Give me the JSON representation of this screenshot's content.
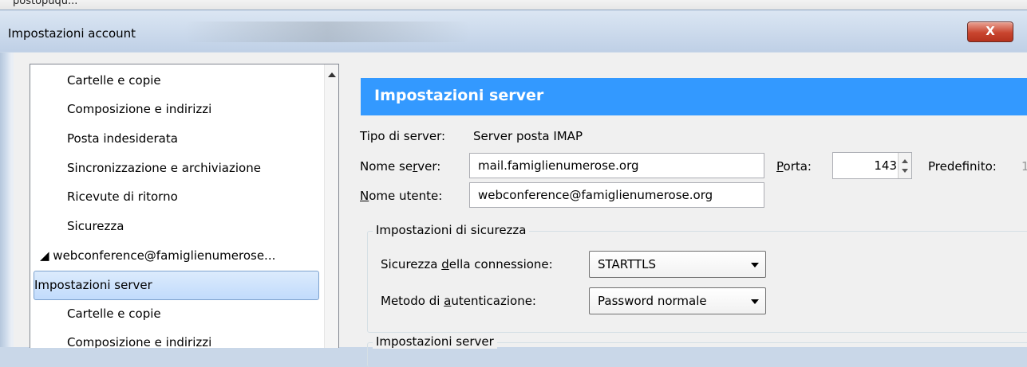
{
  "window": {
    "title": "Impostazioni account",
    "close_label": "X",
    "top_strip_text": "postopuqu..."
  },
  "tree": {
    "items": [
      {
        "label": "Cartelle e copie",
        "type": "child"
      },
      {
        "label": "Composizione e indirizzi",
        "type": "child"
      },
      {
        "label": "Posta indesiderata",
        "type": "child"
      },
      {
        "label": "Sincronizzazione e archiviazione",
        "type": "child"
      },
      {
        "label": "Ricevute di ritorno",
        "type": "child"
      },
      {
        "label": "Sicurezza",
        "type": "child"
      },
      {
        "label": "◢ webconference@famiglienumerose...",
        "type": "parent"
      },
      {
        "label": "Impostazioni server",
        "type": "selected"
      },
      {
        "label": "Cartelle e copie",
        "type": "child"
      },
      {
        "label": "Composizione e indirizzi",
        "type": "child"
      }
    ]
  },
  "panel": {
    "header": "Impostazioni server",
    "server_type_label": "Tipo di server:",
    "server_type_value": "Server posta IMAP",
    "server_name_label_pre": "Nome se",
    "server_name_label_ul": "r",
    "server_name_label_post": "ver:",
    "server_name_value": "mail.famiglienumerose.org",
    "port_label_ul": "P",
    "port_label_post": "orta:",
    "port_value": "143",
    "default_label": "Predefinito:",
    "default_value": "1",
    "username_label_ul": "N",
    "username_label_post": "ome utente:",
    "username_value": "webconference@famiglienumerose.org",
    "security_group_label": "Impostazioni di sicurezza",
    "connection_security_label_pre": "Sicurezza ",
    "connection_security_label_ul": "d",
    "connection_security_label_post": "ella connessione:",
    "connection_security_value": "STARTTLS",
    "auth_method_label_pre": "Metodo di ",
    "auth_method_label_ul": "a",
    "auth_method_label_post": "utenticazione:",
    "auth_method_value": "Password normale",
    "server_group_label": "Impostazioni server"
  },
  "colors": {
    "header_bg": "#3399ff",
    "selection_bg": "#c1dbfc",
    "close_button": "#c9452f"
  }
}
